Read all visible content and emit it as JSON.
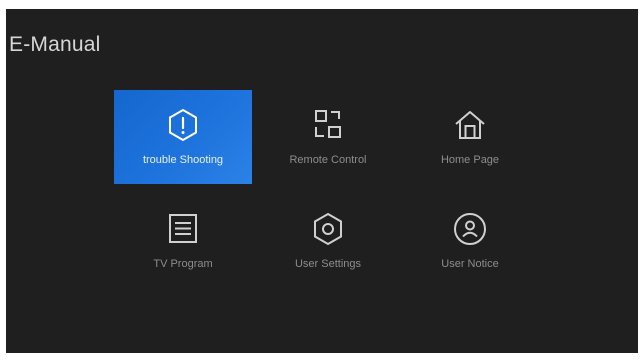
{
  "app": {
    "title": "E-Manual"
  },
  "menu": {
    "items": [
      {
        "label": "trouble Shooting",
        "icon": "warning-hexagon-icon",
        "selected": true
      },
      {
        "label": "Remote Control",
        "icon": "remote-control-icon",
        "selected": false
      },
      {
        "label": "Home Page",
        "icon": "home-icon",
        "selected": false
      },
      {
        "label": "TV Program",
        "icon": "tv-program-icon",
        "selected": false
      },
      {
        "label": "User Settings",
        "icon": "settings-hexagon-icon",
        "selected": false
      },
      {
        "label": "User Notice",
        "icon": "user-notice-icon",
        "selected": false
      }
    ]
  },
  "colors": {
    "background": "#1f1f1f",
    "selected_tile": "#1e73dc",
    "icon": "#d0d0d0",
    "label": "#8d8d8d"
  }
}
